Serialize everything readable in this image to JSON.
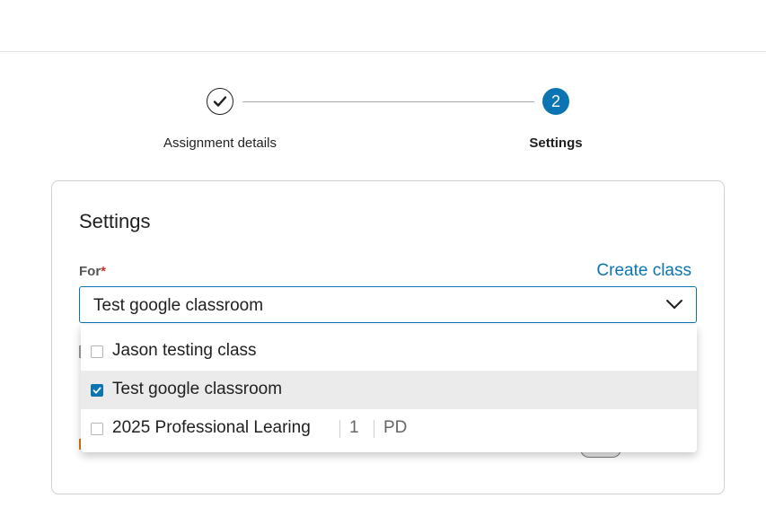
{
  "stepper": {
    "steps": [
      {
        "label": "Assignment details",
        "status": "complete"
      },
      {
        "label": "Settings",
        "number": "2",
        "status": "current"
      }
    ]
  },
  "settings": {
    "title": "Settings",
    "for_label": "For",
    "required_mark": "*",
    "create_class_link": "Create class",
    "selected_value": "Test google classroom"
  },
  "dropdown": {
    "options": [
      {
        "label": "Jason testing class",
        "checked": false
      },
      {
        "label": "Test google classroom",
        "checked": true
      },
      {
        "label": "2025 Professional Learing",
        "checked": false,
        "meta": [
          "1",
          "PD"
        ]
      }
    ]
  },
  "colors": {
    "accent": "#0b74b3",
    "selected_row_bg": "#ebebeb",
    "required": "#c0392b"
  },
  "icons": {
    "step_done": "checkmark-icon",
    "select_toggle": "chevron-down-icon",
    "checkbox_checked": "check-icon"
  }
}
